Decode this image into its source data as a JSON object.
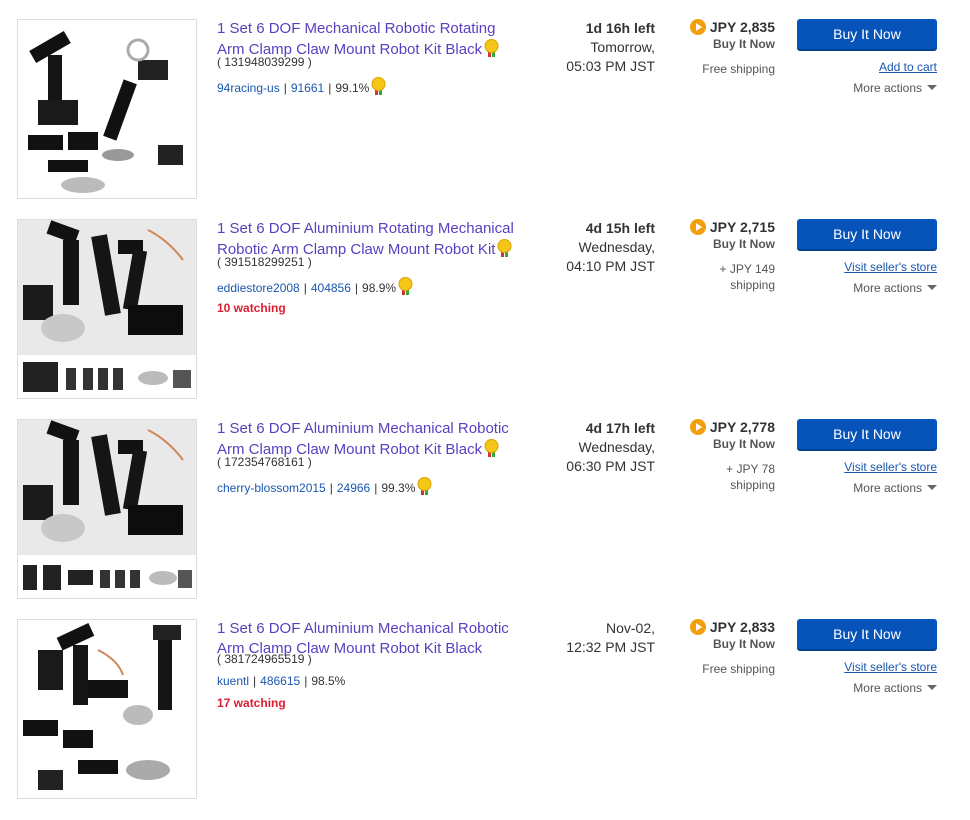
{
  "listings": [
    {
      "title": "1 Set 6 DOF Mechanical Robotic Rotating Arm Clamp Claw Mount Robot Kit Black",
      "item_number": "( 131948039299 )",
      "seller": "94racing-us",
      "feedback_count": "91661",
      "feedback_percent": "99.1%",
      "watching": "",
      "time_left": "1d 16h left",
      "end_day": "Tomorrow,",
      "end_time": "05:03 PM JST",
      "price": "JPY 2,835",
      "format": "Buy It Now",
      "shipping_1": "Free shipping",
      "shipping_2": "",
      "buy_button": "Buy It Now",
      "secondary_link": "Add to cart",
      "more_actions": "More actions"
    },
    {
      "title": "1 Set 6 DOF Aluminium Rotating Mechanical Robotic Arm Clamp Claw Mount Robot Kit",
      "item_number": "( 391518299251 )",
      "seller": "eddiestore2008",
      "feedback_count": "404856",
      "feedback_percent": "98.9%",
      "watching": "10 watching",
      "time_left": "4d 15h left",
      "end_day": "Wednesday,",
      "end_time": "04:10 PM JST",
      "price": "JPY 2,715",
      "format": "Buy It Now",
      "shipping_1": "+ JPY 149",
      "shipping_2": "shipping",
      "buy_button": "Buy It Now",
      "secondary_link": "Visit seller's store",
      "more_actions": "More actions"
    },
    {
      "title": "1 Set 6 DOF Aluminium Mechanical Robotic Arm Clamp Claw Mount Robot Kit Black",
      "item_number": "( 172354768161 )",
      "seller": "cherry-blossom2015",
      "feedback_count": "24966",
      "feedback_percent": "99.3%",
      "watching": "",
      "time_left": "4d 17h left",
      "end_day": "Wednesday,",
      "end_time": "06:30 PM JST",
      "price": "JPY 2,778",
      "format": "Buy It Now",
      "shipping_1": "+ JPY 78",
      "shipping_2": "shipping",
      "buy_button": "Buy It Now",
      "secondary_link": "Visit seller's store",
      "more_actions": "More actions"
    },
    {
      "title": "1 Set 6 DOF Aluminium Mechanical Robotic Arm Clamp Claw Mount Robot Kit Black",
      "item_number": "( 381724965519 )",
      "seller": "kuentl",
      "feedback_count": "486615",
      "feedback_percent": "98.5%",
      "watching": "17 watching",
      "time_left": "",
      "end_day": "Nov-02,",
      "end_time": "12:32 PM JST",
      "price": "JPY 2,833",
      "format": "Buy It Now",
      "shipping_1": "Free shipping",
      "shipping_2": "",
      "buy_button": "Buy It Now",
      "secondary_link": "Visit seller's store",
      "more_actions": "More actions"
    }
  ],
  "colors": {
    "title_link": "#5a3fc0",
    "link": "#1a57b0",
    "button": "#0654ba",
    "watching": "#dd1e31",
    "bin_icon": "#f29e0d"
  }
}
